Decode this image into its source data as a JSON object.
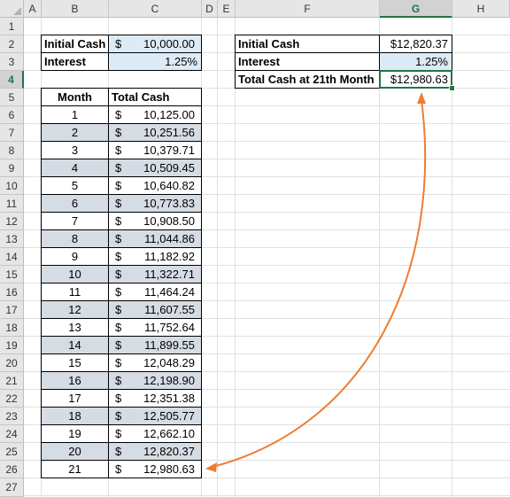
{
  "columns": [
    "A",
    "B",
    "C",
    "D",
    "E",
    "F",
    "G",
    "H"
  ],
  "selected_column": "G",
  "rows": [
    "1",
    "2",
    "3",
    "4",
    "5",
    "6",
    "7",
    "8",
    "9",
    "10",
    "11",
    "12",
    "13",
    "14",
    "15",
    "16",
    "17",
    "18",
    "19",
    "20",
    "21",
    "22",
    "23",
    "24",
    "25",
    "26",
    "27"
  ],
  "selected_row": "4",
  "left_inputs": {
    "initial_cash_label": "Initial Cash",
    "initial_cash_symbol": "$",
    "initial_cash_value": "10,000.00",
    "interest_label": "Interest",
    "interest_value": "1.25%"
  },
  "table": {
    "header_month": "Month",
    "header_total": "Total Cash",
    "rows": [
      {
        "month": "1",
        "symbol": "$",
        "value": "10,125.00"
      },
      {
        "month": "2",
        "symbol": "$",
        "value": "10,251.56"
      },
      {
        "month": "3",
        "symbol": "$",
        "value": "10,379.71"
      },
      {
        "month": "4",
        "symbol": "$",
        "value": "10,509.45"
      },
      {
        "month": "5",
        "symbol": "$",
        "value": "10,640.82"
      },
      {
        "month": "6",
        "symbol": "$",
        "value": "10,773.83"
      },
      {
        "month": "7",
        "symbol": "$",
        "value": "10,908.50"
      },
      {
        "month": "8",
        "symbol": "$",
        "value": "11,044.86"
      },
      {
        "month": "9",
        "symbol": "$",
        "value": "11,182.92"
      },
      {
        "month": "10",
        "symbol": "$",
        "value": "11,322.71"
      },
      {
        "month": "11",
        "symbol": "$",
        "value": "11,464.24"
      },
      {
        "month": "12",
        "symbol": "$",
        "value": "11,607.55"
      },
      {
        "month": "13",
        "symbol": "$",
        "value": "11,752.64"
      },
      {
        "month": "14",
        "symbol": "$",
        "value": "11,899.55"
      },
      {
        "month": "15",
        "symbol": "$",
        "value": "12,048.29"
      },
      {
        "month": "16",
        "symbol": "$",
        "value": "12,198.90"
      },
      {
        "month": "17",
        "symbol": "$",
        "value": "12,351.38"
      },
      {
        "month": "18",
        "symbol": "$",
        "value": "12,505.77"
      },
      {
        "month": "19",
        "symbol": "$",
        "value": "12,662.10"
      },
      {
        "month": "20",
        "symbol": "$",
        "value": "12,820.37"
      },
      {
        "month": "21",
        "symbol": "$",
        "value": "12,980.63"
      }
    ]
  },
  "right_summary": {
    "initial_cash_label": "Initial Cash",
    "initial_cash_value": "$12,820.37",
    "interest_label": "Interest",
    "interest_value": "1.25%",
    "total_label": "Total Cash at 21th Month",
    "total_value": "$12,980.63"
  },
  "colors": {
    "input_fill": "#ddebf7",
    "stripe_fill": "#d6dce4",
    "selection": "#217346",
    "arrow": "#ed7d31"
  }
}
